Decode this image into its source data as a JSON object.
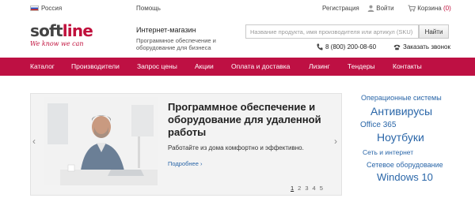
{
  "topbar": {
    "region": "Россия",
    "help": "Помощь",
    "register": "Регистрация",
    "login": "Войти",
    "cart": "Корзина",
    "cart_count": "(0)"
  },
  "header": {
    "logo_text_main": "soft",
    "logo_text_accent": "line",
    "logo_tagline": "We know we can",
    "shop_title": "Интернет-магазин",
    "shop_subtitle": "Программное обеспечение и оборудование для бизнеса",
    "search_placeholder": "Название продукта, имя производителя или артикул (SKU)",
    "search_button": "Найти",
    "phone": "8 (800) 200-08-60",
    "callback": "Заказать звонок"
  },
  "nav": {
    "items": [
      {
        "label": "Каталог"
      },
      {
        "label": "Производители"
      },
      {
        "label": "Запрос цены"
      },
      {
        "label": "Акции"
      },
      {
        "label": "Оплата и доставка"
      },
      {
        "label": "Лизинг"
      },
      {
        "label": "Тендеры"
      },
      {
        "label": "Контакты"
      }
    ]
  },
  "banner": {
    "title": "Программное обеспечение и оборудование для удаленной работы",
    "text": "Работайте из дома комфортно и эффективно.",
    "more": "Подробнее ›",
    "pages": [
      "1",
      "2",
      "3",
      "4",
      "5"
    ],
    "active_page": "1",
    "prev_arrow": "‹",
    "next_arrow": "›"
  },
  "tags": [
    {
      "label": "Операционные системы"
    },
    {
      "label": "Антивирусы"
    },
    {
      "label": "Office 365"
    },
    {
      "label": "Ноутбуки"
    },
    {
      "label": "Сеть и интернет"
    },
    {
      "label": "Сетевое оборудование"
    },
    {
      "label": "Windows 10"
    }
  ],
  "colors": {
    "brand": "#be1043",
    "link": "#2a66a8"
  }
}
